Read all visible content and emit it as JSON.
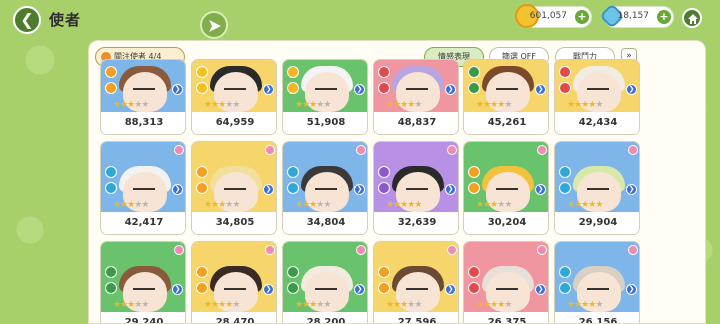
{
  "header": {
    "title": "使者",
    "back_icon": "chevron-left-icon",
    "gold": "601,057",
    "gems": "18,157",
    "plus": "+",
    "home_icon": "home-icon"
  },
  "filters": {
    "favorites": "關注使者 4/4",
    "emotion": "情感表現",
    "filter": "篩選 OFF",
    "power": "戰鬥力",
    "expand": "»"
  },
  "colors": {
    "accent_green": "#69a836",
    "star_on": "#f3b623",
    "star_off": "#b7b7b7",
    "panel": "#fffdf4"
  },
  "cards": [
    {
      "power": "88,313",
      "bg": "#7eb6ea",
      "hair": "#8a5a3c",
      "el": "#f2a020",
      "stars": 3
    },
    {
      "power": "64,959",
      "bg": "#f6d56a",
      "hair": "#2a2a2a",
      "el": "#f2c020",
      "stars": 3
    },
    {
      "power": "51,908",
      "bg": "#69c36d",
      "hair": "#f4f4f4",
      "el": "#f3b623",
      "stars": 3
    },
    {
      "power": "48,837",
      "bg": "#f096a0",
      "hair": "#b9a6e0",
      "el": "#e04a4a",
      "stars": 4
    },
    {
      "power": "45,261",
      "bg": "#f6d56a",
      "hair": "#7b4a2a",
      "el": "#3b9a4a",
      "stars": 4
    },
    {
      "power": "42,434",
      "bg": "#f6d56a",
      "hair": "#f1ede2",
      "el": "#e04a4a",
      "stars": 4
    },
    {
      "power": "42,417",
      "bg": "#7eb6ea",
      "hair": "#f2f2f2",
      "el": "#2fa8d8",
      "stars": 3
    },
    {
      "power": "34,805",
      "bg": "#f6d56a",
      "hair": "#f1df9a",
      "el": "#f2a020",
      "stars": 3
    },
    {
      "power": "34,804",
      "bg": "#7eb6ea",
      "hair": "#3a3a3a",
      "el": "#2fa8d8",
      "stars": 3
    },
    {
      "power": "32,639",
      "bg": "#b891e6",
      "hair": "#2a2a2a",
      "el": "#8a58c8",
      "stars": 5
    },
    {
      "power": "30,204",
      "bg": "#69c36d",
      "hair": "#f2c23c",
      "el": "#f2a020",
      "stars": 3
    },
    {
      "power": "29,904",
      "bg": "#7eb6ea",
      "hair": "#d8e8a8",
      "el": "#2fa8d8",
      "stars": 5
    },
    {
      "power": "29,240",
      "bg": "#69c36d",
      "hair": "#8a5a3c",
      "el": "#3b9a4a",
      "stars": 3
    },
    {
      "power": "28,470",
      "bg": "#f6d56a",
      "hair": "#3a2a22",
      "el": "#f2a020",
      "stars": 4
    },
    {
      "power": "28,200",
      "bg": "#69c36d",
      "hair": "#f1ebe0",
      "el": "#3b9a4a",
      "stars": 3
    },
    {
      "power": "27,596",
      "bg": "#f6d56a",
      "hair": "#6a4a32",
      "el": "#f2a020",
      "stars": 3
    },
    {
      "power": "26,375",
      "bg": "#f096a0",
      "hair": "#e8e0d8",
      "el": "#e04a4a",
      "stars": 4
    },
    {
      "power": "26,156",
      "bg": "#7eb6ea",
      "hair": "#d8cfc5",
      "el": "#2fa8d8",
      "stars": 4
    }
  ]
}
